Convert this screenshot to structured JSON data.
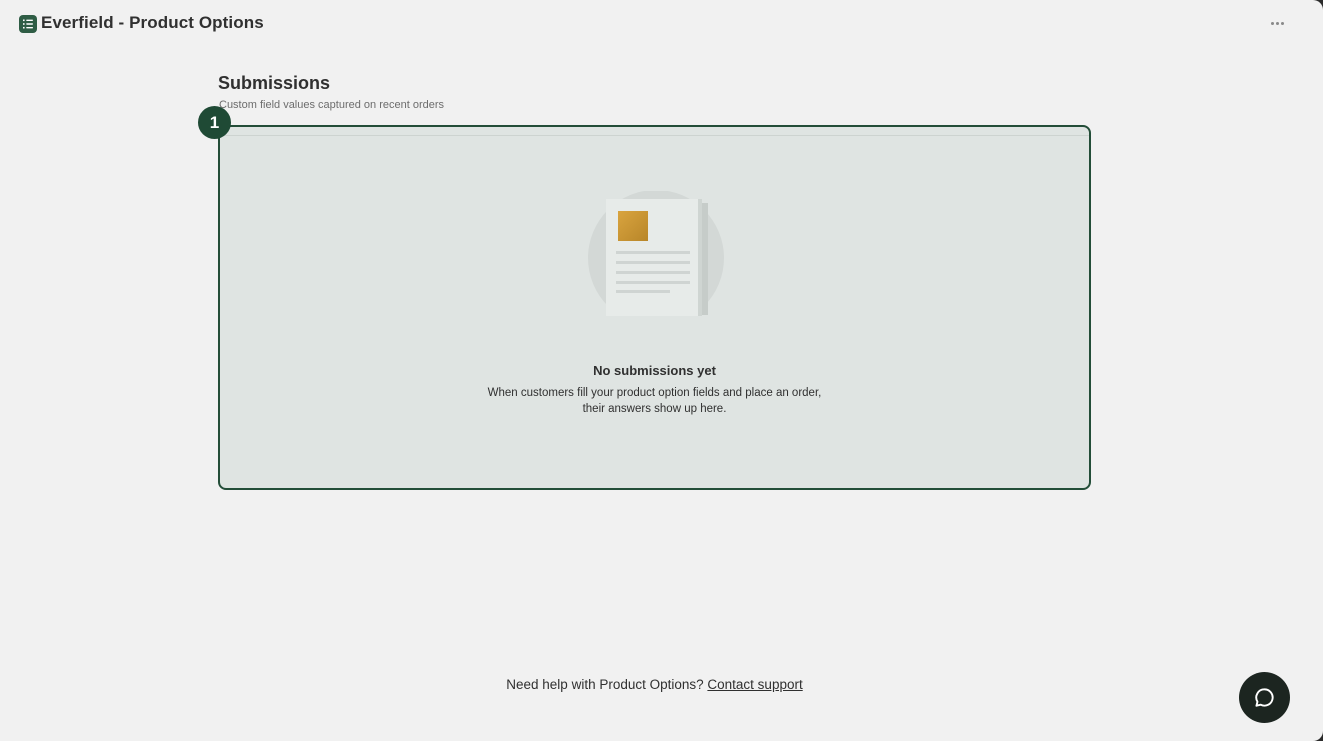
{
  "app": {
    "title": "Everfield - Product Options",
    "brand_color": "#2f5d45",
    "logo_icon": "list-icon",
    "more_icon": "ellipsis-icon"
  },
  "page": {
    "title": "Submissions",
    "subtitle": "Custom field values captured on recent orders"
  },
  "step_badge": {
    "number": "1",
    "color": "#1f4a35"
  },
  "empty_state": {
    "illustration_icon": "document-icon",
    "title": "No submissions yet",
    "body_line_1": "When customers fill your product option fields and place an order,",
    "body_line_2": "their answers show up here."
  },
  "footer": {
    "help_text": "Need help with Product Options?",
    "link_label": "Contact support"
  },
  "chat": {
    "icon": "chat-bubble-icon",
    "color": "#1c2520"
  }
}
